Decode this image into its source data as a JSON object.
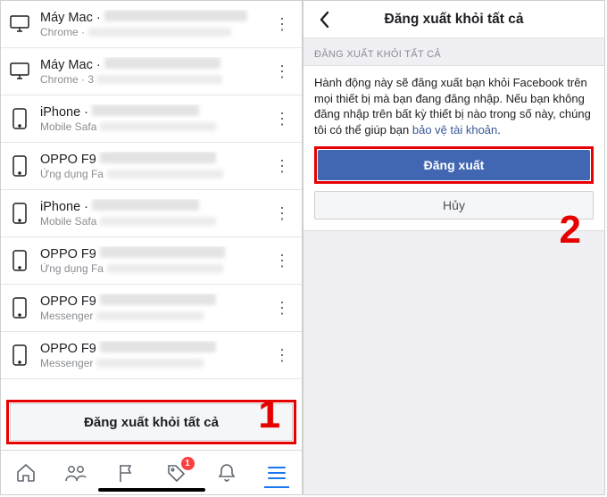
{
  "left": {
    "devices": [
      {
        "icon": "desktop",
        "title": "Máy Mac ·",
        "sub": "Chrome ·",
        "titleBlurW": 160,
        "subBlurW": 160
      },
      {
        "icon": "desktop",
        "title": "Máy Mac ·",
        "sub": "Chrome · 3",
        "titleBlurW": 130,
        "subBlurW": 140
      },
      {
        "icon": "phone",
        "title": "iPhone ·",
        "sub": "Mobile Safa",
        "titleBlurW": 120,
        "subBlurW": 130
      },
      {
        "icon": "phone",
        "title": "OPPO F9",
        "sub": "Ứng dụng Fa",
        "titleBlurW": 130,
        "subBlurW": 130
      },
      {
        "icon": "phone",
        "title": "iPhone ·",
        "sub": "Mobile Safa",
        "titleBlurW": 120,
        "subBlurW": 130
      },
      {
        "icon": "phone",
        "title": "OPPO F9",
        "sub": "Ứng dụng Fa",
        "titleBlurW": 140,
        "subBlurW": 130
      },
      {
        "icon": "phone",
        "title": "OPPO F9",
        "sub": "Messenger",
        "titleBlurW": 130,
        "subBlurW": 120
      },
      {
        "icon": "phone",
        "title": "OPPO F9",
        "sub": "Messenger",
        "titleBlurW": 130,
        "subBlurW": 120
      }
    ],
    "logoutAll": "Đăng xuất khỏi tất cả",
    "badgeCount": "1",
    "stepLabel": "1"
  },
  "right": {
    "headerTitle": "Đăng xuất khỏi tất cả",
    "sectionCaption": "ĐĂNG XUẤT KHỎI TẤT CẢ",
    "bodyText": "Hành động này sẽ đăng xuất bạn khỏi Facebook trên mọi thiết bị mà bạn đang đăng nhập. Nếu bạn không đăng nhập trên bất kỳ thiết bị nào trong số này, chúng tôi có thể giúp bạn ",
    "bodyLink": "bảo vệ tài khoản",
    "logoutLabel": "Đăng xuất",
    "cancelLabel": "Hủy",
    "stepLabel": "2"
  }
}
